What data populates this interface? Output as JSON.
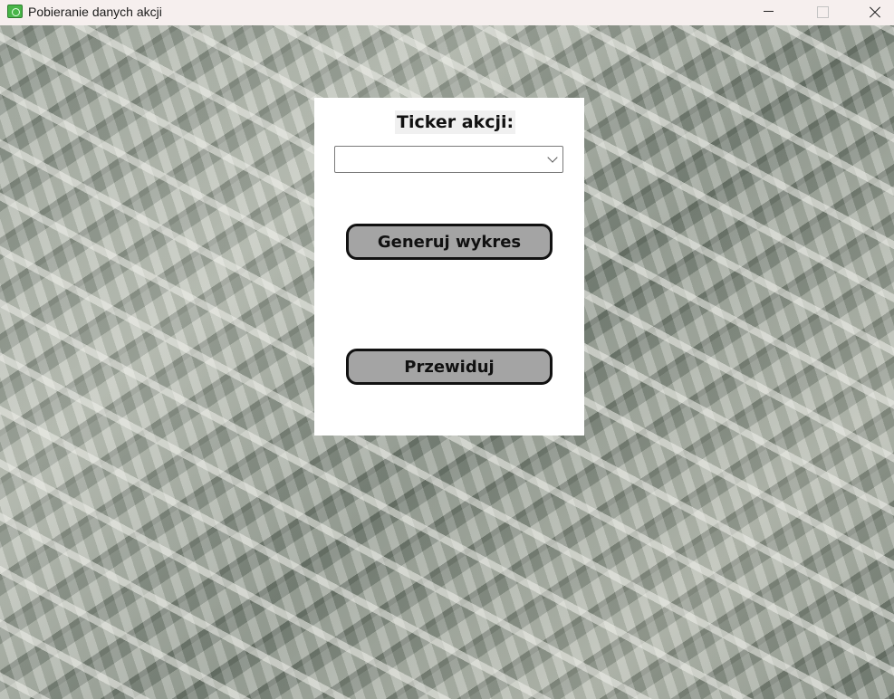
{
  "window": {
    "title": "Pobieranie danych akcji",
    "icon": "money-icon"
  },
  "form": {
    "ticker_label": "Ticker akcji:",
    "ticker_value": "",
    "generate_label": "Generuj wykres",
    "predict_label": "Przewiduj"
  },
  "colors": {
    "button_bg": "#a4a4a4",
    "panel_bg": "#ffffff"
  }
}
